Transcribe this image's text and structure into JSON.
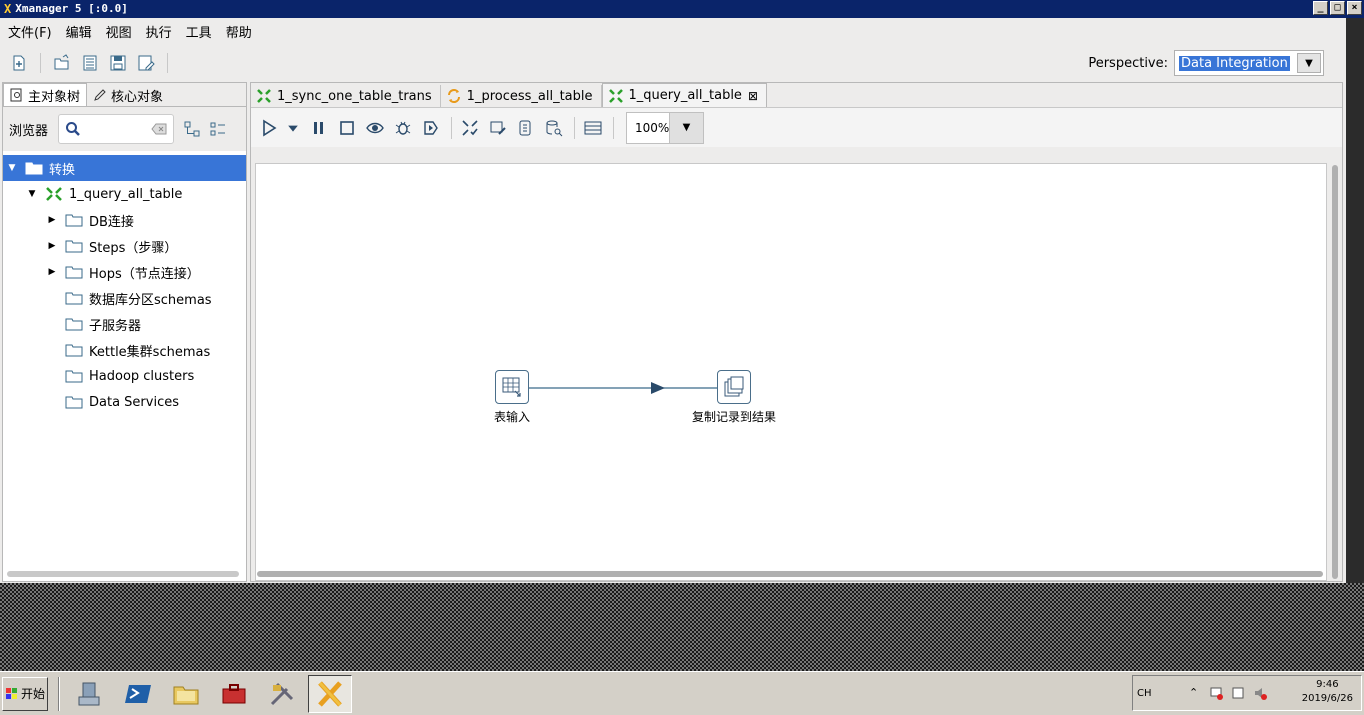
{
  "window": {
    "title": "Xmanager 5 [:0.0]"
  },
  "menu": [
    "文件(F)",
    "编辑",
    "视图",
    "执行",
    "工具",
    "帮助"
  ],
  "perspective": {
    "label": "Perspective:",
    "value": "Data Integration"
  },
  "left_panel": {
    "tabs": [
      "主对象树",
      "核心对象"
    ],
    "browser_label": "浏览器",
    "tree": [
      {
        "label": "转换",
        "depth": 0,
        "expanded": true,
        "selected": true,
        "icon": "folder-icon"
      },
      {
        "label": "1_query_all_table",
        "depth": 1,
        "expanded": true,
        "icon": "transformation-icon"
      },
      {
        "label": "DB连接",
        "depth": 2,
        "collapsed": true,
        "icon": "folder-icon"
      },
      {
        "label": "Steps（步骤）",
        "depth": 2,
        "collapsed": true,
        "icon": "folder-icon"
      },
      {
        "label": "Hops（节点连接）",
        "depth": 2,
        "collapsed": true,
        "icon": "folder-icon"
      },
      {
        "label": "数据库分区schemas",
        "depth": 2,
        "icon": "folder-icon"
      },
      {
        "label": "子服务器",
        "depth": 2,
        "icon": "folder-icon"
      },
      {
        "label": "Kettle集群schemas",
        "depth": 2,
        "icon": "folder-icon"
      },
      {
        "label": "Hadoop clusters",
        "depth": 2,
        "icon": "folder-icon"
      },
      {
        "label": "Data Services",
        "depth": 2,
        "icon": "folder-icon"
      }
    ]
  },
  "editor": {
    "tabs": [
      {
        "label": "1_sync_one_table_trans",
        "icon": "transformation-icon",
        "active": false
      },
      {
        "label": "1_process_all_table",
        "icon": "job-icon",
        "active": false
      },
      {
        "label": "1_query_all_table",
        "icon": "transformation-icon",
        "active": true,
        "closable": true
      }
    ],
    "zoom": "100%",
    "steps": [
      {
        "name": "表输入",
        "icon": "table-input-icon"
      },
      {
        "name": "复制记录到结果",
        "icon": "copy-rows-icon"
      }
    ]
  },
  "taskbar": {
    "start_label": "开始",
    "lang": "CH",
    "clock_time": "9:46",
    "clock_date": "2019/6/26"
  },
  "colors": {
    "selection": "#3875d7",
    "title_bar": "#0a246a",
    "hop": "#3a6a8a"
  }
}
